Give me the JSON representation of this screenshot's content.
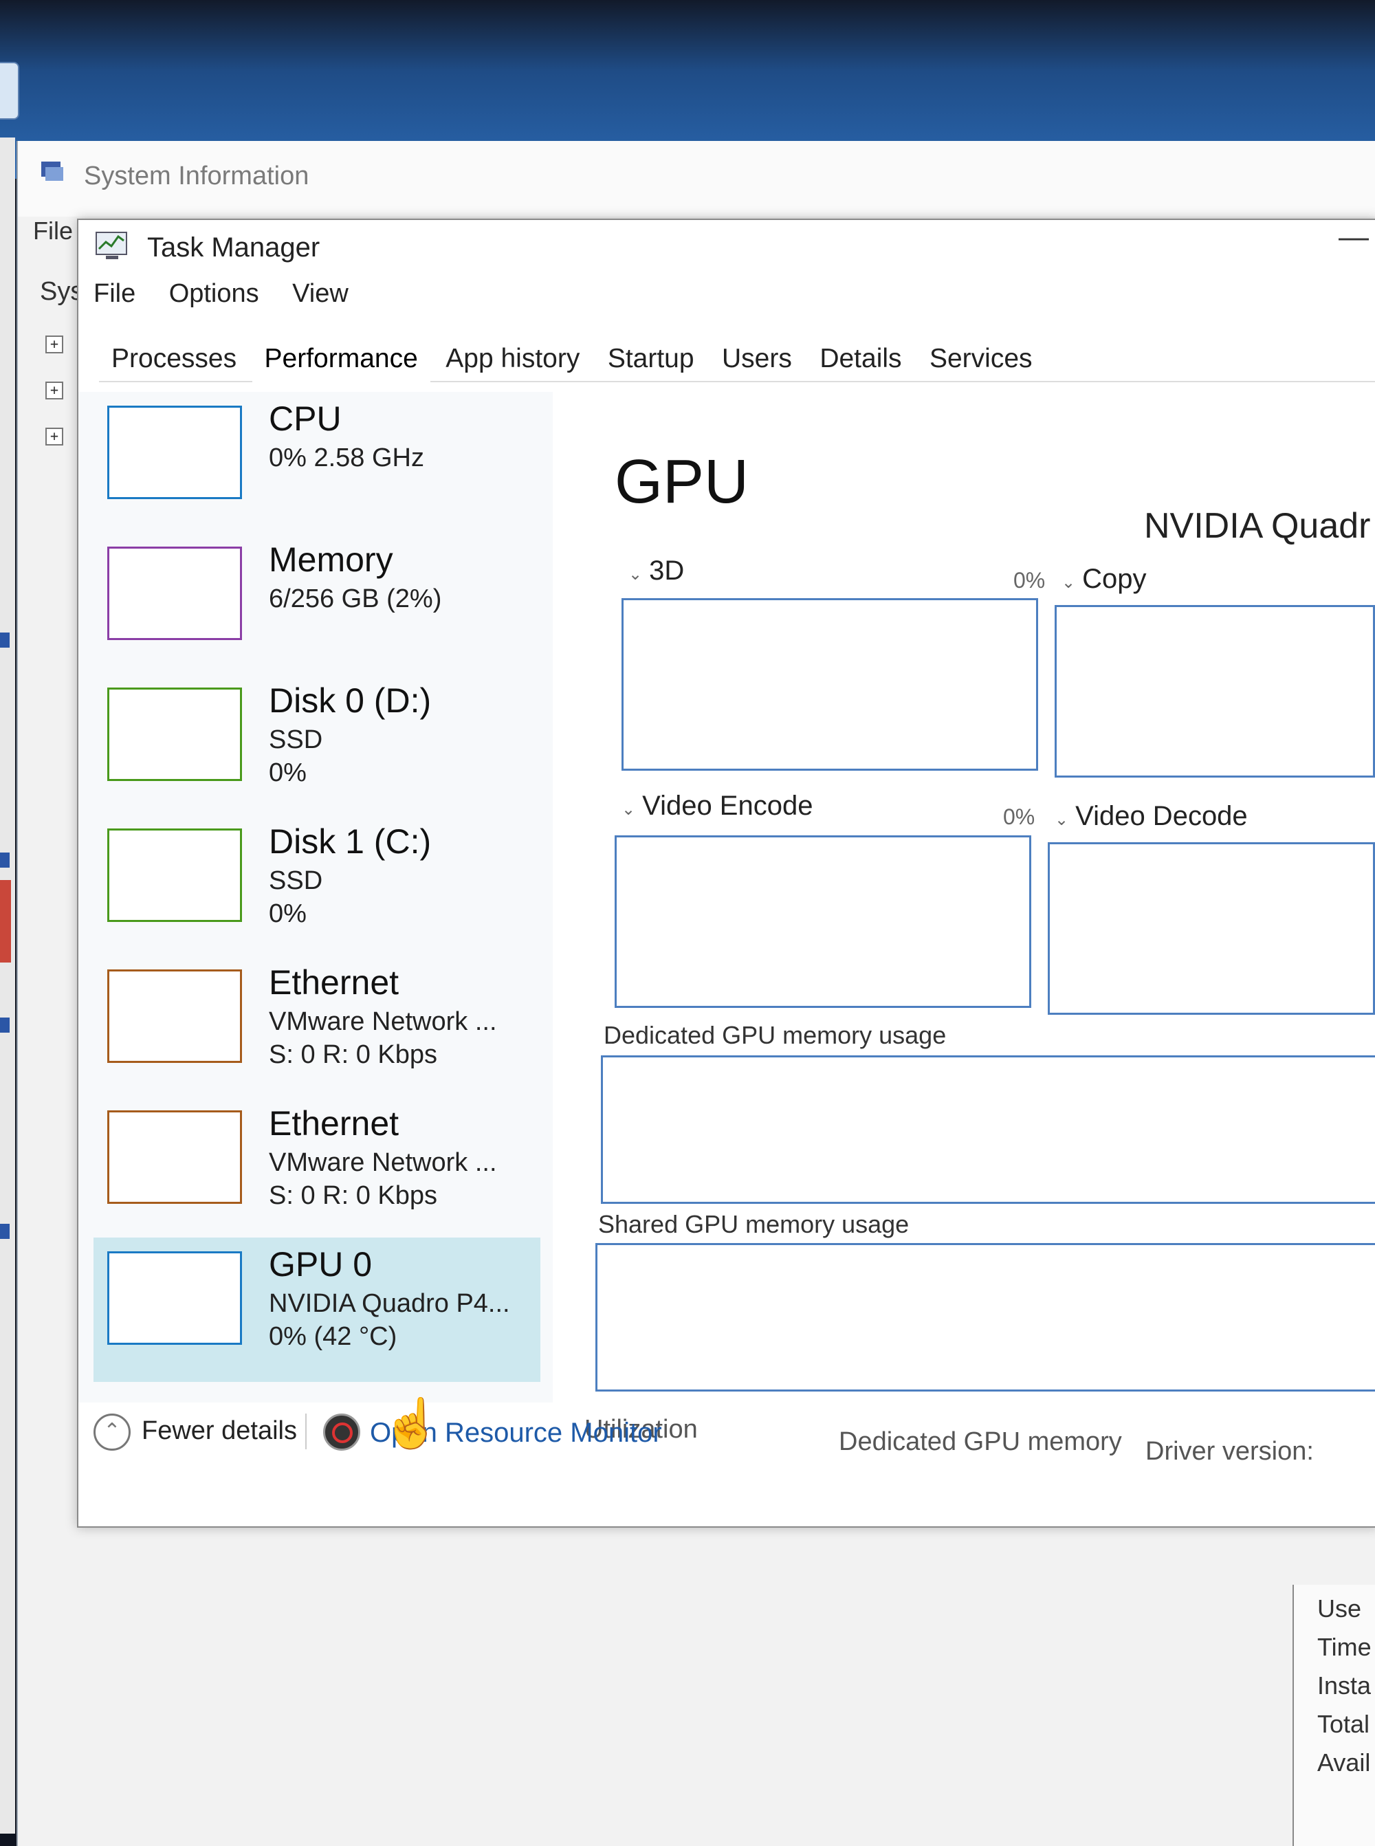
{
  "system_information": {
    "title": "System Information",
    "menu_file": "File",
    "tree_root": "Sys",
    "summary_labels": [
      "Use",
      "Time",
      "Insta",
      "Total",
      "Avail"
    ]
  },
  "task_manager": {
    "title": "Task Manager",
    "menu": [
      "File",
      "Options",
      "View"
    ],
    "minimize_glyph": "—",
    "tabs": [
      "Processes",
      "Performance",
      "App history",
      "Startup",
      "Users",
      "Details",
      "Services"
    ],
    "active_tab": "Performance",
    "perf_list": [
      {
        "name": "CPU",
        "lines": [
          "0% 2.58 GHz"
        ],
        "color": "#1a7ac4"
      },
      {
        "name": "Memory",
        "lines": [
          "6/256 GB (2%)"
        ],
        "color": "#8b3ea6"
      },
      {
        "name": "Disk 0 (D:)",
        "lines": [
          "SSD",
          "0%"
        ],
        "color": "#4a9a1c"
      },
      {
        "name": "Disk 1 (C:)",
        "lines": [
          "SSD",
          "0%"
        ],
        "color": "#4a9a1c"
      },
      {
        "name": "Ethernet",
        "lines": [
          "VMware Network ...",
          "S: 0 R: 0 Kbps"
        ],
        "color": "#a65c1c"
      },
      {
        "name": "Ethernet",
        "lines": [
          "VMware Network ...",
          "S: 0 R: 0 Kbps"
        ],
        "color": "#a65c1c"
      },
      {
        "name": "GPU 0",
        "lines": [
          "NVIDIA Quadro P4...",
          "0% (42 °C)"
        ],
        "color": "#1a7ac4",
        "selected": true
      }
    ],
    "gpu_detail": {
      "title": "GPU",
      "model": "NVIDIA Quadr",
      "engines": [
        {
          "label": "3D",
          "pct": "0%"
        },
        {
          "label": "Copy",
          "pct": ""
        },
        {
          "label": "Video Encode",
          "pct": "0%"
        },
        {
          "label": "Video Decode",
          "pct": ""
        }
      ],
      "dedicated_label": "Dedicated GPU memory usage",
      "shared_label": "Shared GPU memory usage",
      "bottom_labels": {
        "utilization": "Utilization",
        "dedicated_memory": "Dedicated GPU memory",
        "driver_version": "Driver version:"
      }
    },
    "footer": {
      "fewer_details": "Fewer details",
      "open_resource_monitor": "Open Resource Monitor"
    }
  },
  "colors": {
    "graph_border": "#4d7fc0",
    "selected_bg": "#cde8ef",
    "link": "#1e5aa8"
  }
}
